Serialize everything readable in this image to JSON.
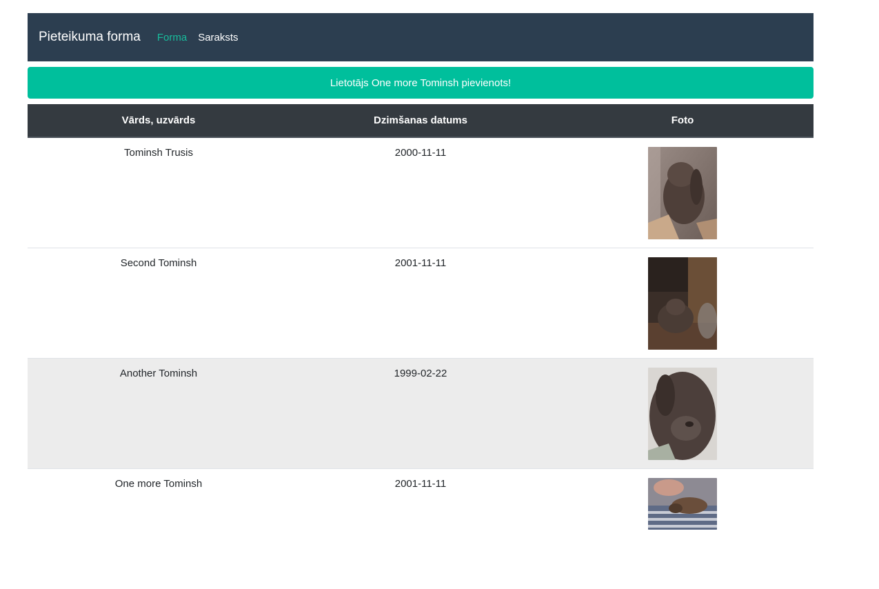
{
  "navbar": {
    "brand": "Pieteikuma forma",
    "links": [
      {
        "label": "Forma",
        "active": true
      },
      {
        "label": "Saraksts",
        "active": false
      }
    ]
  },
  "alert": {
    "message": "Lietotājs One more Tominsh pievienots!",
    "color": "#00bf9c"
  },
  "table": {
    "headers": [
      "Vārds, uzvārds",
      "Dzimšanas datums",
      "Foto"
    ],
    "rows": [
      {
        "name": "Tominsh Trusis",
        "birthdate": "2000-11-11",
        "photo": "rabbit-photo"
      },
      {
        "name": "Second Tominsh",
        "birthdate": "2001-11-11",
        "photo": "rabbit-photo"
      },
      {
        "name": "Another Tominsh",
        "birthdate": "1999-02-22",
        "photo": "rabbit-photo"
      },
      {
        "name": "One more Tominsh",
        "birthdate": "2001-11-11",
        "photo": "rabbit-photo"
      }
    ]
  },
  "colors": {
    "navbar_bg": "#2c3e50",
    "accent": "#18bc9c",
    "table_header_bg": "#343a40",
    "stripe_bg": "#ececec"
  }
}
